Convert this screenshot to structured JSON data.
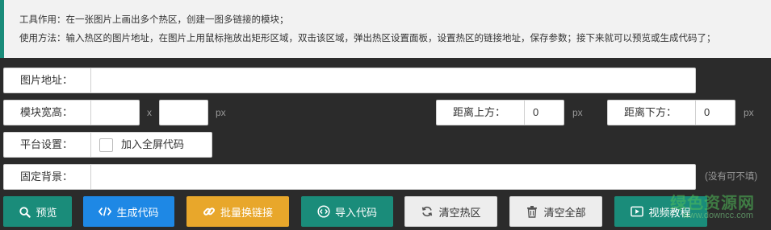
{
  "info": {
    "line1": "工具作用：在一张图片上画出多个热区，创建一图多链接的模块；",
    "line2": "使用方法：输入热区的图片地址，在图片上用鼠标拖放出矩形区域，双击该区域，弹出热区设置面板，设置热区的链接地址，保存参数；接下来就可以预览或生成代码了；"
  },
  "image_url": {
    "label": "图片地址：",
    "value": ""
  },
  "size": {
    "label": "模块宽高：",
    "width": "",
    "height": "",
    "x": "x",
    "unit": "px",
    "top_label": "距离上方：",
    "top_value": "0",
    "top_unit": "px",
    "bottom_label": "距离下方：",
    "bottom_value": "0",
    "bottom_unit": "px"
  },
  "platform": {
    "label": "平台设置：",
    "fullscreen_label": "加入全屏代码",
    "fullscreen_checked": false
  },
  "background": {
    "label": "固定背景：",
    "value": "",
    "hint": "(没有可不填)"
  },
  "buttons": {
    "preview": "预览",
    "generate": "生成代码",
    "batch": "批量换链接",
    "import": "导入代码",
    "clear_hotspots": "清空热区",
    "clear_all": "清空全部",
    "video": "视频教程"
  },
  "watermark": {
    "brand": "绿色资源网",
    "url": "www.downcc.com"
  }
}
